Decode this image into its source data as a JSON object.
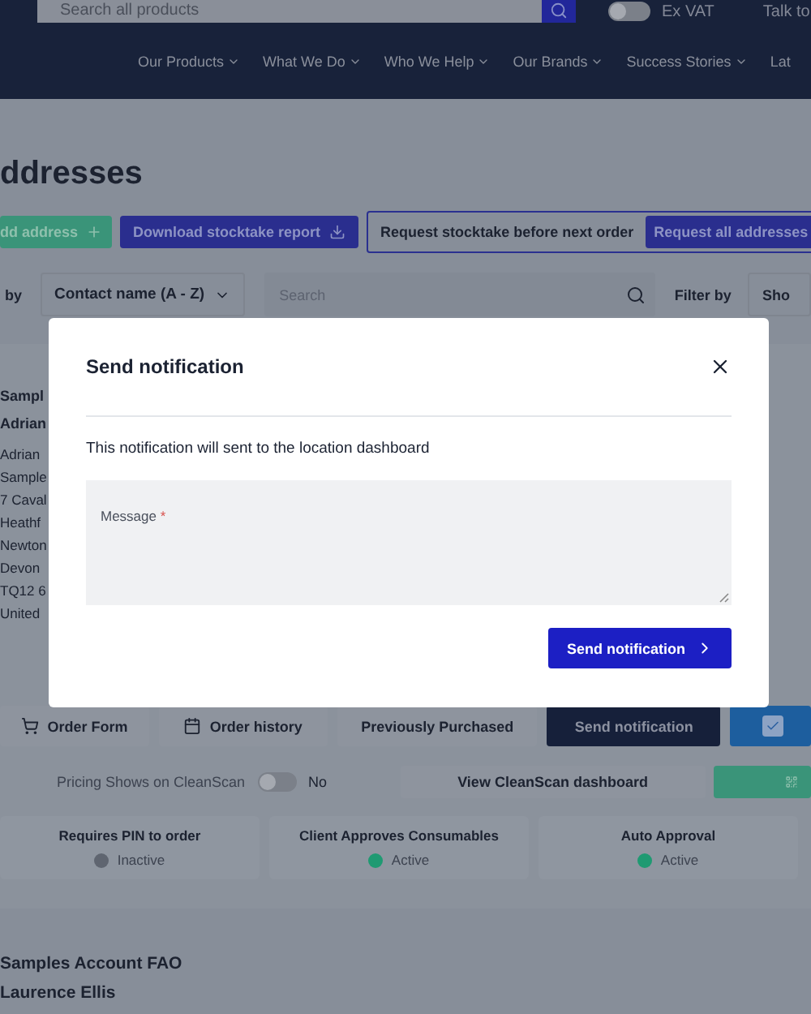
{
  "header": {
    "search": {
      "placeholder": "Search all products"
    },
    "price_toggle": {
      "label": "Ex VAT",
      "on": false
    },
    "contact": "Talk to",
    "nav": [
      {
        "label": "Our Products",
        "dropdown": true
      },
      {
        "label": "What We Do",
        "dropdown": true
      },
      {
        "label": "Who We Help",
        "dropdown": true
      },
      {
        "label": "Our Brands",
        "dropdown": true
      },
      {
        "label": "Success Stories",
        "dropdown": true
      },
      {
        "label": "Lat",
        "dropdown": false
      }
    ]
  },
  "page": {
    "title": "ddresses",
    "actions": {
      "add_button": "dd address",
      "download_button": "Download stocktake report",
      "stocktake": {
        "label": "Request stocktake before next order",
        "button": "Request all addresses"
      }
    },
    "sort": {
      "label": "by",
      "value": "Contact name (A - Z)"
    },
    "search": {
      "placeholder": "Search"
    },
    "filter": {
      "label": "Filter by",
      "value": "Sho"
    },
    "address_card": {
      "heading": [
        "Sampl",
        "Adrian"
      ],
      "lines": [
        "Adrian",
        "Sample",
        "7 Caval",
        "Heathf",
        "Newton",
        "Devon",
        "TQ12 6",
        "United"
      ],
      "tabs": [
        {
          "label": "Order Form",
          "selected": false
        },
        {
          "label": "Order history",
          "selected": false
        },
        {
          "label": "Previously Purchased",
          "selected": false
        },
        {
          "label": "Send notification",
          "selected": true
        }
      ],
      "select_checkbox": {
        "checked": true
      },
      "pricing": {
        "label": "Pricing Shows on CleanScan",
        "on": false,
        "value": "No"
      },
      "dashboard_button": "View CleanScan dashboard",
      "statuses": [
        {
          "label": "Requires PIN to order",
          "status": "Inactive",
          "color": "#5f6570"
        },
        {
          "label": "Client Approves Consumables",
          "status": "Active",
          "color": "#1f9a72"
        },
        {
          "label": "Auto Approval",
          "status": "Active",
          "color": "#1f9a72"
        }
      ]
    },
    "next_card": {
      "heading": [
        "Samples Account FAO",
        "Laurence Ellis"
      ]
    }
  },
  "modal": {
    "title": "Send notification",
    "description": "This notification will sent to the location dashboard",
    "message": {
      "label": "Message",
      "required_mark": "*"
    },
    "submit": "Send notification"
  }
}
